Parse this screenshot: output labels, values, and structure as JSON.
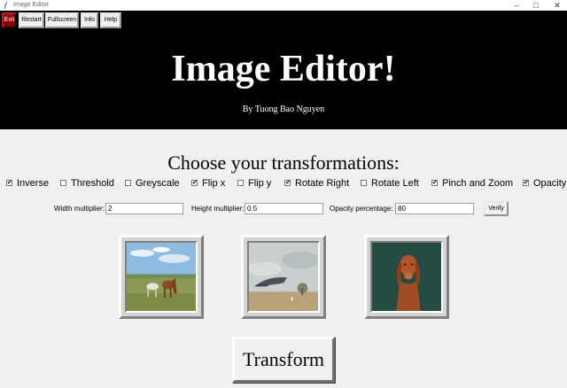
{
  "window": {
    "title": "Image Editor"
  },
  "menu": {
    "exit": "Exit",
    "restart": "Restart",
    "fullscreen": "Fullscreen",
    "info": "Info",
    "help": "Help"
  },
  "header": {
    "title": "Image Editor!",
    "byline": "By Tuong Bao Nguyen"
  },
  "subtitle": "Choose your transformations:",
  "options": [
    {
      "label": "Inverse",
      "checked": true
    },
    {
      "label": "Threshold",
      "checked": false
    },
    {
      "label": "Greyscale",
      "checked": false
    },
    {
      "label": "Flip x",
      "checked": true
    },
    {
      "label": "Flip y",
      "checked": false
    },
    {
      "label": "Rotate Right",
      "checked": true
    },
    {
      "label": "Rotate Left",
      "checked": false
    },
    {
      "label": "Pinch and Zoom",
      "checked": true
    },
    {
      "label": "Opacity",
      "checked": true
    }
  ],
  "params": {
    "width_label": "Width multiplier:",
    "width_value": "2",
    "height_label": "Height multiplier:",
    "height_value": "0.5",
    "opacity_label": "Opacity percentage:",
    "opacity_value": "80",
    "verify": "Verify"
  },
  "images": [
    "horses-thumbnail",
    "whale-thumbnail",
    "dog-thumbnail"
  ],
  "transform_button": "Transform",
  "colors": {
    "banner": "#000000",
    "exit_button": "#8b0000",
    "background": "#f0f0f0"
  }
}
